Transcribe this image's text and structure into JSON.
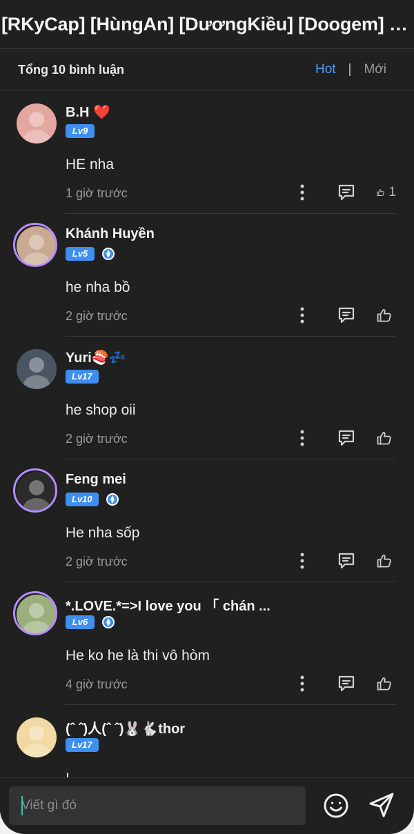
{
  "title": "[RKyCap] [HùngAn] [DươngKiều] [Doogem] Ma Tôn ...",
  "header": {
    "count_label": "Tổng 10 bình luận",
    "sort_hot": "Hot",
    "sort_separator": "|",
    "sort_new": "Mới"
  },
  "comments": [
    {
      "name": "B.H ❤️",
      "level": "Lv9",
      "verified": false,
      "text": "HE nha",
      "time": "1 giờ trước",
      "likes": "1",
      "avatar_color": "#e3a7a0"
    },
    {
      "name": "Khánh Huyền",
      "level": "Lv5",
      "verified": true,
      "text": "he nha bồ",
      "time": "2 giờ trước",
      "likes": "",
      "avatar_color": "#c9a992"
    },
    {
      "name": "Yuri🍣💤",
      "level": "Lv17",
      "verified": false,
      "text": "he shop oii",
      "time": "2 giờ trước",
      "likes": "",
      "avatar_color": "#4a5563"
    },
    {
      "name": "Feng mei",
      "level": "Lv10",
      "verified": true,
      "text": "He nha sốp",
      "time": "2 giờ trước",
      "likes": "",
      "avatar_color": "#2b2b2b"
    },
    {
      "name": "*.LOVE.*=>I love you 「 chán ...",
      "level": "Lv6",
      "verified": true,
      "text": "He ko he là thi vô hòm",
      "time": "4 giờ trước",
      "likes": "",
      "avatar_color": "#9ab07c"
    },
    {
      "name": "(ˆ ˆ)人(ˆ ˆ)🐰🐇thor",
      "level": "Lv17",
      "verified": false,
      "text": "!",
      "time": "",
      "likes": "",
      "avatar_color": "#f1d9a3"
    }
  ],
  "composer": {
    "placeholder": "Viết gì đó"
  },
  "icons": {
    "more": "more-vertical-icon",
    "reply": "comment-reply-icon",
    "like": "thumbs-up-icon",
    "emoji": "emoji-icon",
    "send": "send-icon",
    "verified": "verified-badge-icon"
  }
}
